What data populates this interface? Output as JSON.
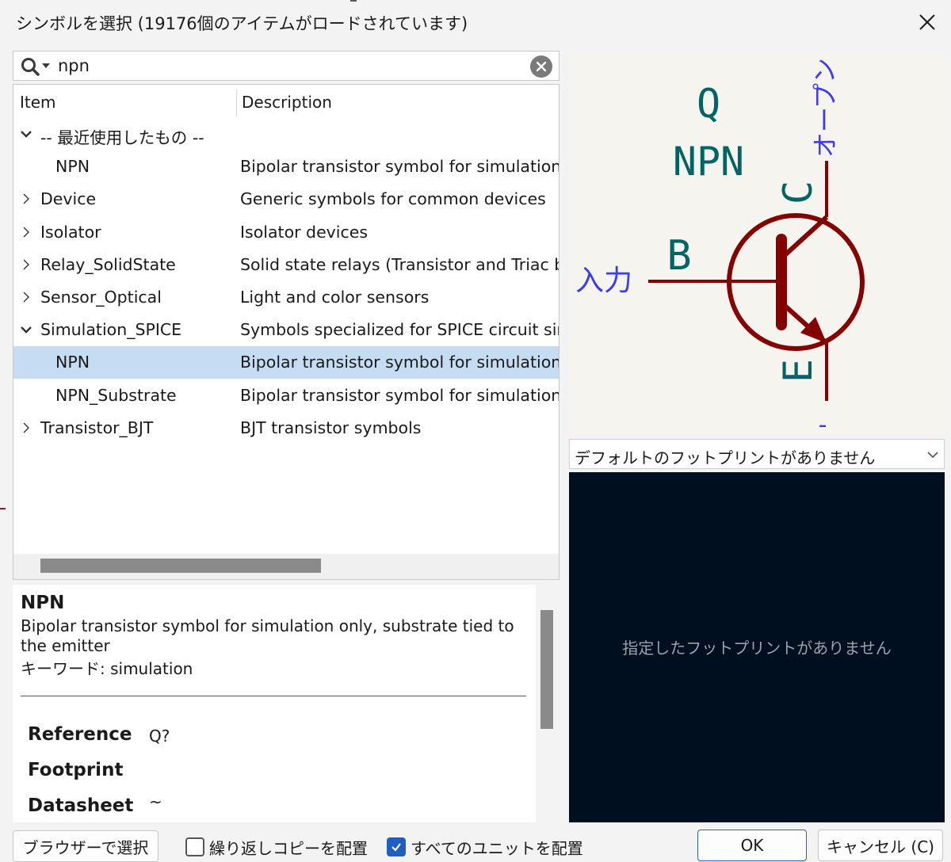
{
  "window": {
    "title": "シンボルを選択 (19176個のアイテムがロードされています)"
  },
  "search": {
    "value": "npn",
    "placeholder": ""
  },
  "tree": {
    "columns": [
      "Item",
      "Description"
    ],
    "rows": [
      {
        "name": "-- 最近使用したもの --",
        "desc": "",
        "expanded": true,
        "level": 0
      },
      {
        "name": "NPN",
        "desc": "Bipolar transistor symbol for simulation only, substrate tied to the emitter",
        "level": 1
      },
      {
        "name": "Device",
        "desc": "Generic symbols for common devices",
        "expanded": false,
        "level": 0
      },
      {
        "name": "Isolator",
        "desc": "Isolator devices",
        "expanded": false,
        "level": 0
      },
      {
        "name": "Relay_SolidState",
        "desc": "Solid state relays (Transistor and Triac based)",
        "expanded": false,
        "level": 0
      },
      {
        "name": "Sensor_Optical",
        "desc": "Light and color sensors",
        "expanded": false,
        "level": 0
      },
      {
        "name": "Simulation_SPICE",
        "desc": "Symbols specialized for SPICE circuit simulation",
        "expanded": true,
        "level": 0
      },
      {
        "name": "NPN",
        "desc": "Bipolar transistor symbol for simulation only, substrate tied to the emitter",
        "level": 1,
        "selected": true
      },
      {
        "name": "NPN_Substrate",
        "desc": "Bipolar transistor symbol for simulation only, with substrate pin",
        "level": 1
      },
      {
        "name": "Transistor_BJT",
        "desc": "BJT transistor symbols",
        "expanded": false,
        "level": 0
      }
    ]
  },
  "details": {
    "name": "NPN",
    "description": "Bipolar transistor symbol for simulation only, substrate tied to the emitter",
    "keywords": "キーワード: simulation",
    "fields": [
      {
        "label": "Reference",
        "value": "Q?"
      },
      {
        "label": "Footprint",
        "value": ""
      },
      {
        "label": "Datasheet",
        "value": "~"
      }
    ]
  },
  "preview": {
    "ref": "Q",
    "value": "NPN",
    "pin_c": "C",
    "pin_b": "B",
    "pin_e": "E",
    "pin_c_type": "オープン",
    "pin_b_type": "入力",
    "pin_e_type": "-",
    "colors": {
      "body": "#840000",
      "field": "#006464",
      "pin_type": "#3c3cf0",
      "background": "#f5f4ef"
    }
  },
  "footprint": {
    "selected": "デフォルトのフットプリントがありません",
    "empty_message": "指定したフットプリントがありません",
    "background": "#000f1f"
  },
  "buttons": {
    "browse": "ブラウザーで選択",
    "repeat_copy": "繰り返しコピーを配置",
    "all_units": "すべてのユニットを配置",
    "ok": "OK",
    "cancel": "キャンセル (C)"
  },
  "checkboxes": {
    "repeat_copy_checked": false,
    "all_units_checked": true
  }
}
